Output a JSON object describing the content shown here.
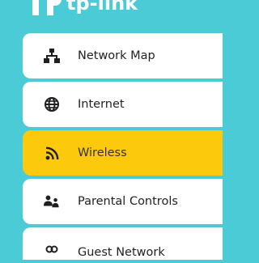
{
  "brand": {
    "logo_text": "tp-link"
  },
  "sidebar": {
    "items": [
      {
        "label": "Network Map",
        "icon": "network-map-icon",
        "active": false
      },
      {
        "label": "Internet",
        "icon": "globe-icon",
        "active": false
      },
      {
        "label": "Wireless",
        "icon": "wireless-icon",
        "active": true
      },
      {
        "label": "Parental Controls",
        "icon": "parental-controls-icon",
        "active": false
      },
      {
        "label": "Guest Network",
        "icon": "guest-network-icon",
        "active": false
      }
    ]
  },
  "colors": {
    "background": "#4acbd6",
    "active_item": "#fcc90d",
    "item_background": "#ffffff",
    "icon": "#1f1f1f"
  }
}
